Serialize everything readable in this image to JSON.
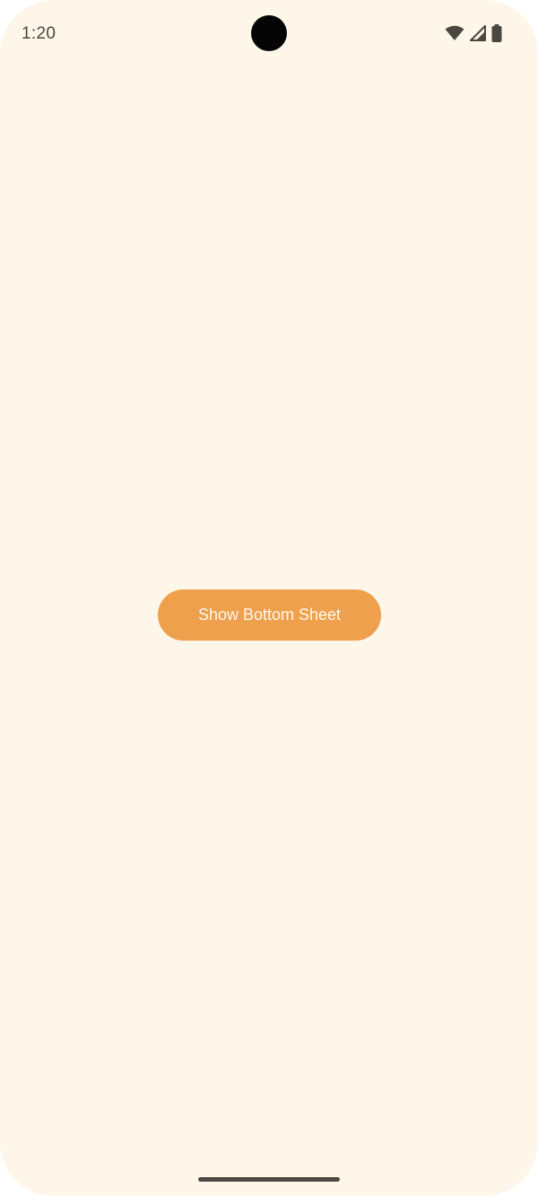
{
  "status_bar": {
    "time": "1:20",
    "icons": [
      "wifi-icon",
      "cellular-signal-icon",
      "battery-icon"
    ]
  },
  "main": {
    "button_label": "Show Bottom Sheet"
  },
  "colors": {
    "background": "#fff6ea",
    "button": "#efa04c",
    "button_text": "#fff8ee",
    "status_text": "#4a4640"
  }
}
